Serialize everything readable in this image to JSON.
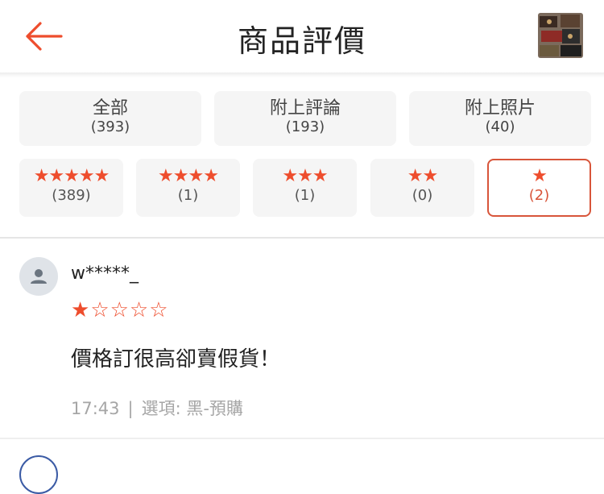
{
  "header": {
    "title": "商品評價",
    "back_icon": "arrow-left-icon",
    "accent": "#ee4d2d"
  },
  "filters": [
    {
      "label": "全部",
      "count": "(393)"
    },
    {
      "label": "附上評論",
      "count": "(193)"
    },
    {
      "label": "附上照片",
      "count": "(40)"
    }
  ],
  "star_filters": [
    {
      "stars": "★★★★★",
      "count": "(389)",
      "selected": false
    },
    {
      "stars": "★★★★",
      "count": "(1)",
      "selected": false
    },
    {
      "stars": "★★★",
      "count": "(1)",
      "selected": false
    },
    {
      "stars": "★★",
      "count": "(0)",
      "selected": false
    },
    {
      "stars": "★",
      "count": "(2)",
      "selected": true
    }
  ],
  "review": {
    "username": "w*****_",
    "rating": 1,
    "rating_max": 5,
    "comment": "價格訂很高卻賣假貨！",
    "time": "17:43",
    "separator": "|",
    "variation": "選項: 黑-預購"
  }
}
